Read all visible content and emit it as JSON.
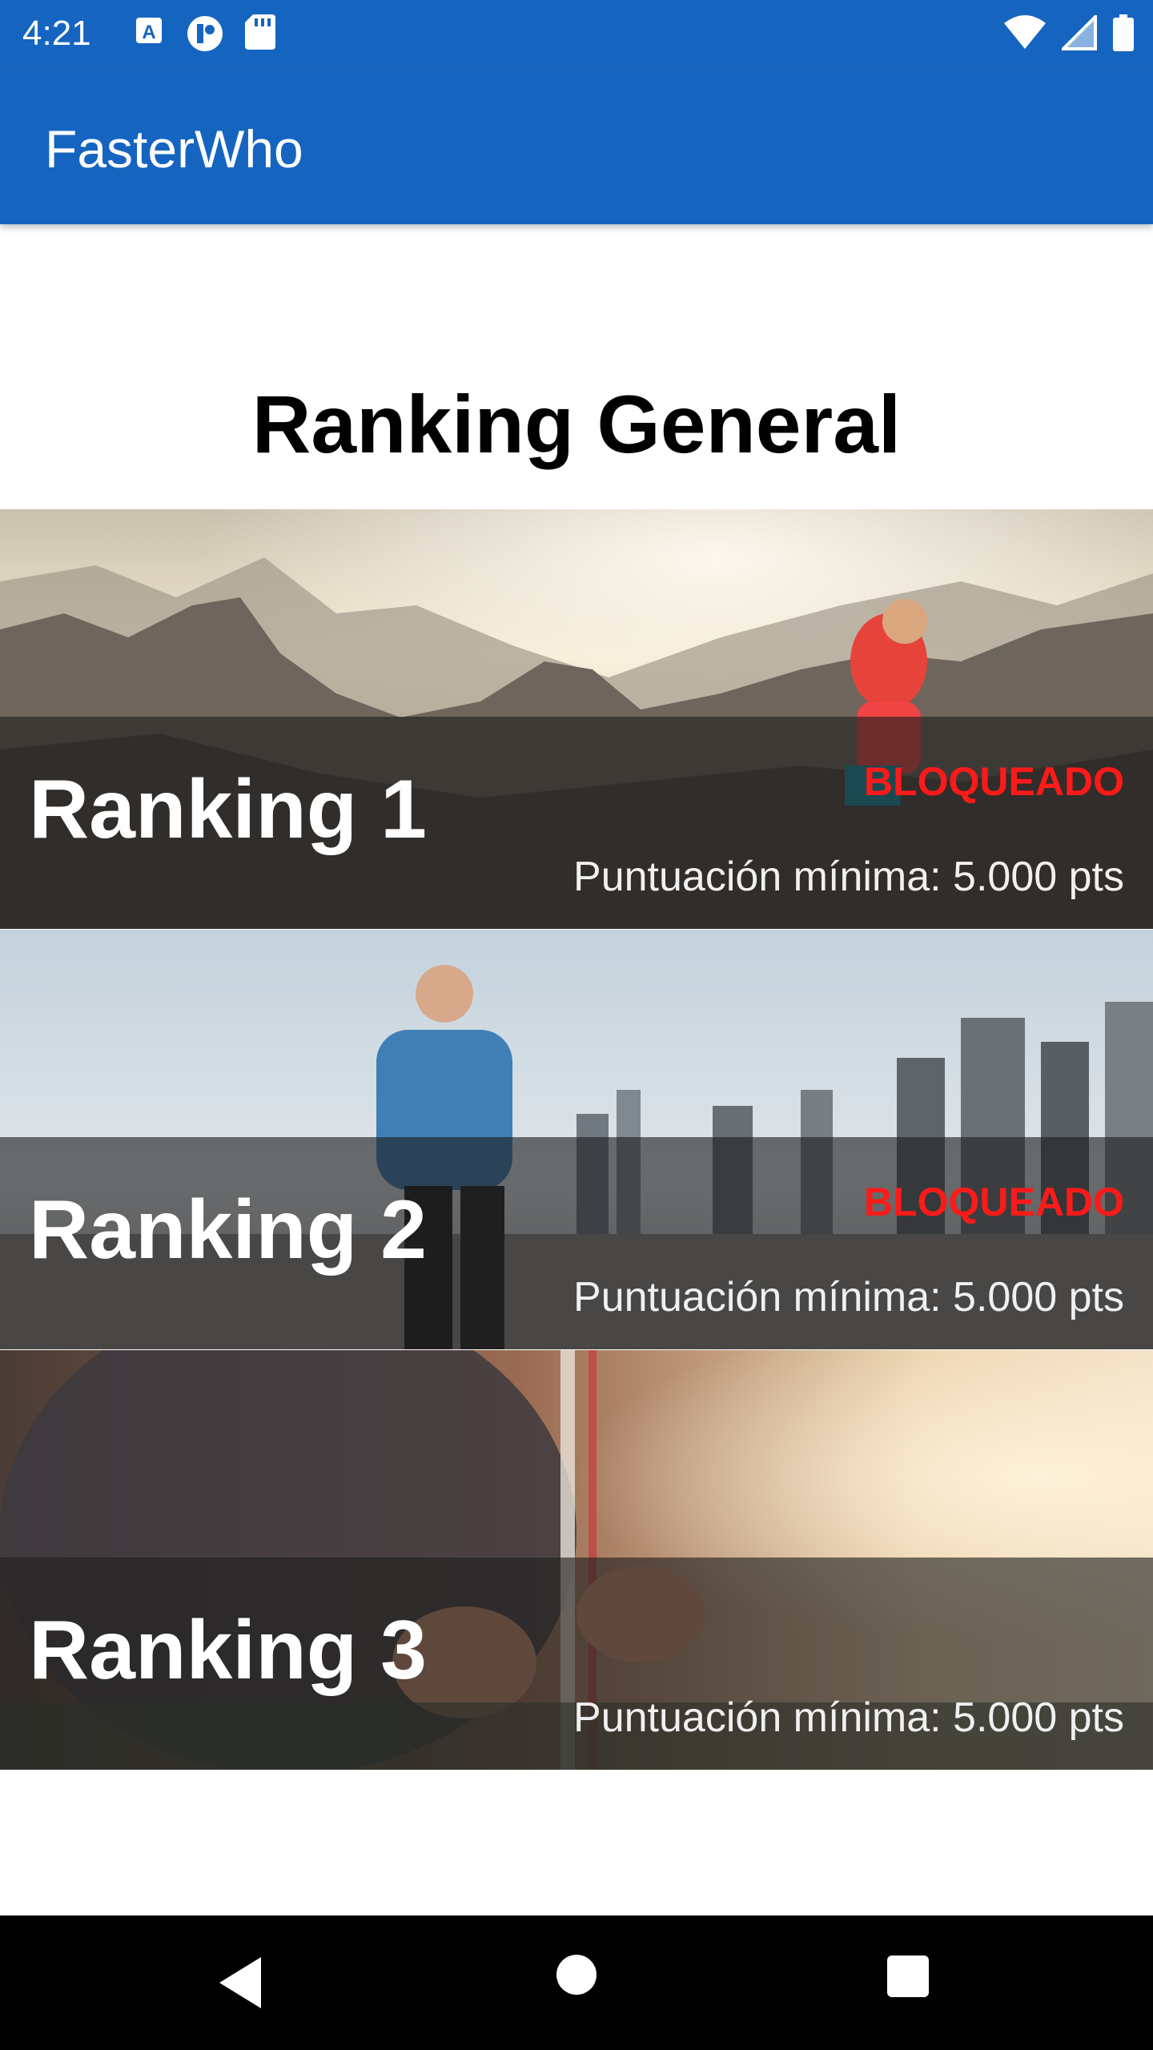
{
  "status_bar": {
    "time": "4:21",
    "left_icons": [
      "accessibility-a-icon",
      "app-notification-icon",
      "sd-card-icon"
    ],
    "right_icons": [
      "wifi-icon",
      "cell-signal-icon",
      "battery-icon"
    ]
  },
  "app_bar": {
    "title": "FasterWho",
    "color": "#1565c0"
  },
  "page": {
    "title": "Ranking General"
  },
  "rankings": [
    {
      "name": "Ranking 1",
      "status": "BLOQUEADO",
      "min_score": "Puntuación mínima: 5.000 pts",
      "image": "mountain-runner-photo"
    },
    {
      "name": "Ranking 2",
      "status": "BLOQUEADO",
      "min_score": "Puntuación mínima: 5.000 pts",
      "image": "city-runner-photo"
    },
    {
      "name": "Ranking 3",
      "status": "",
      "min_score": "Puntuación mínima: 5.000 pts",
      "image": "shoelace-tying-photo"
    }
  ],
  "colors": {
    "locked": "#ff1a1a",
    "nav_bar": "#000000"
  },
  "nav_bar": {
    "buttons": [
      "back-icon",
      "home-icon",
      "recents-icon"
    ]
  }
}
